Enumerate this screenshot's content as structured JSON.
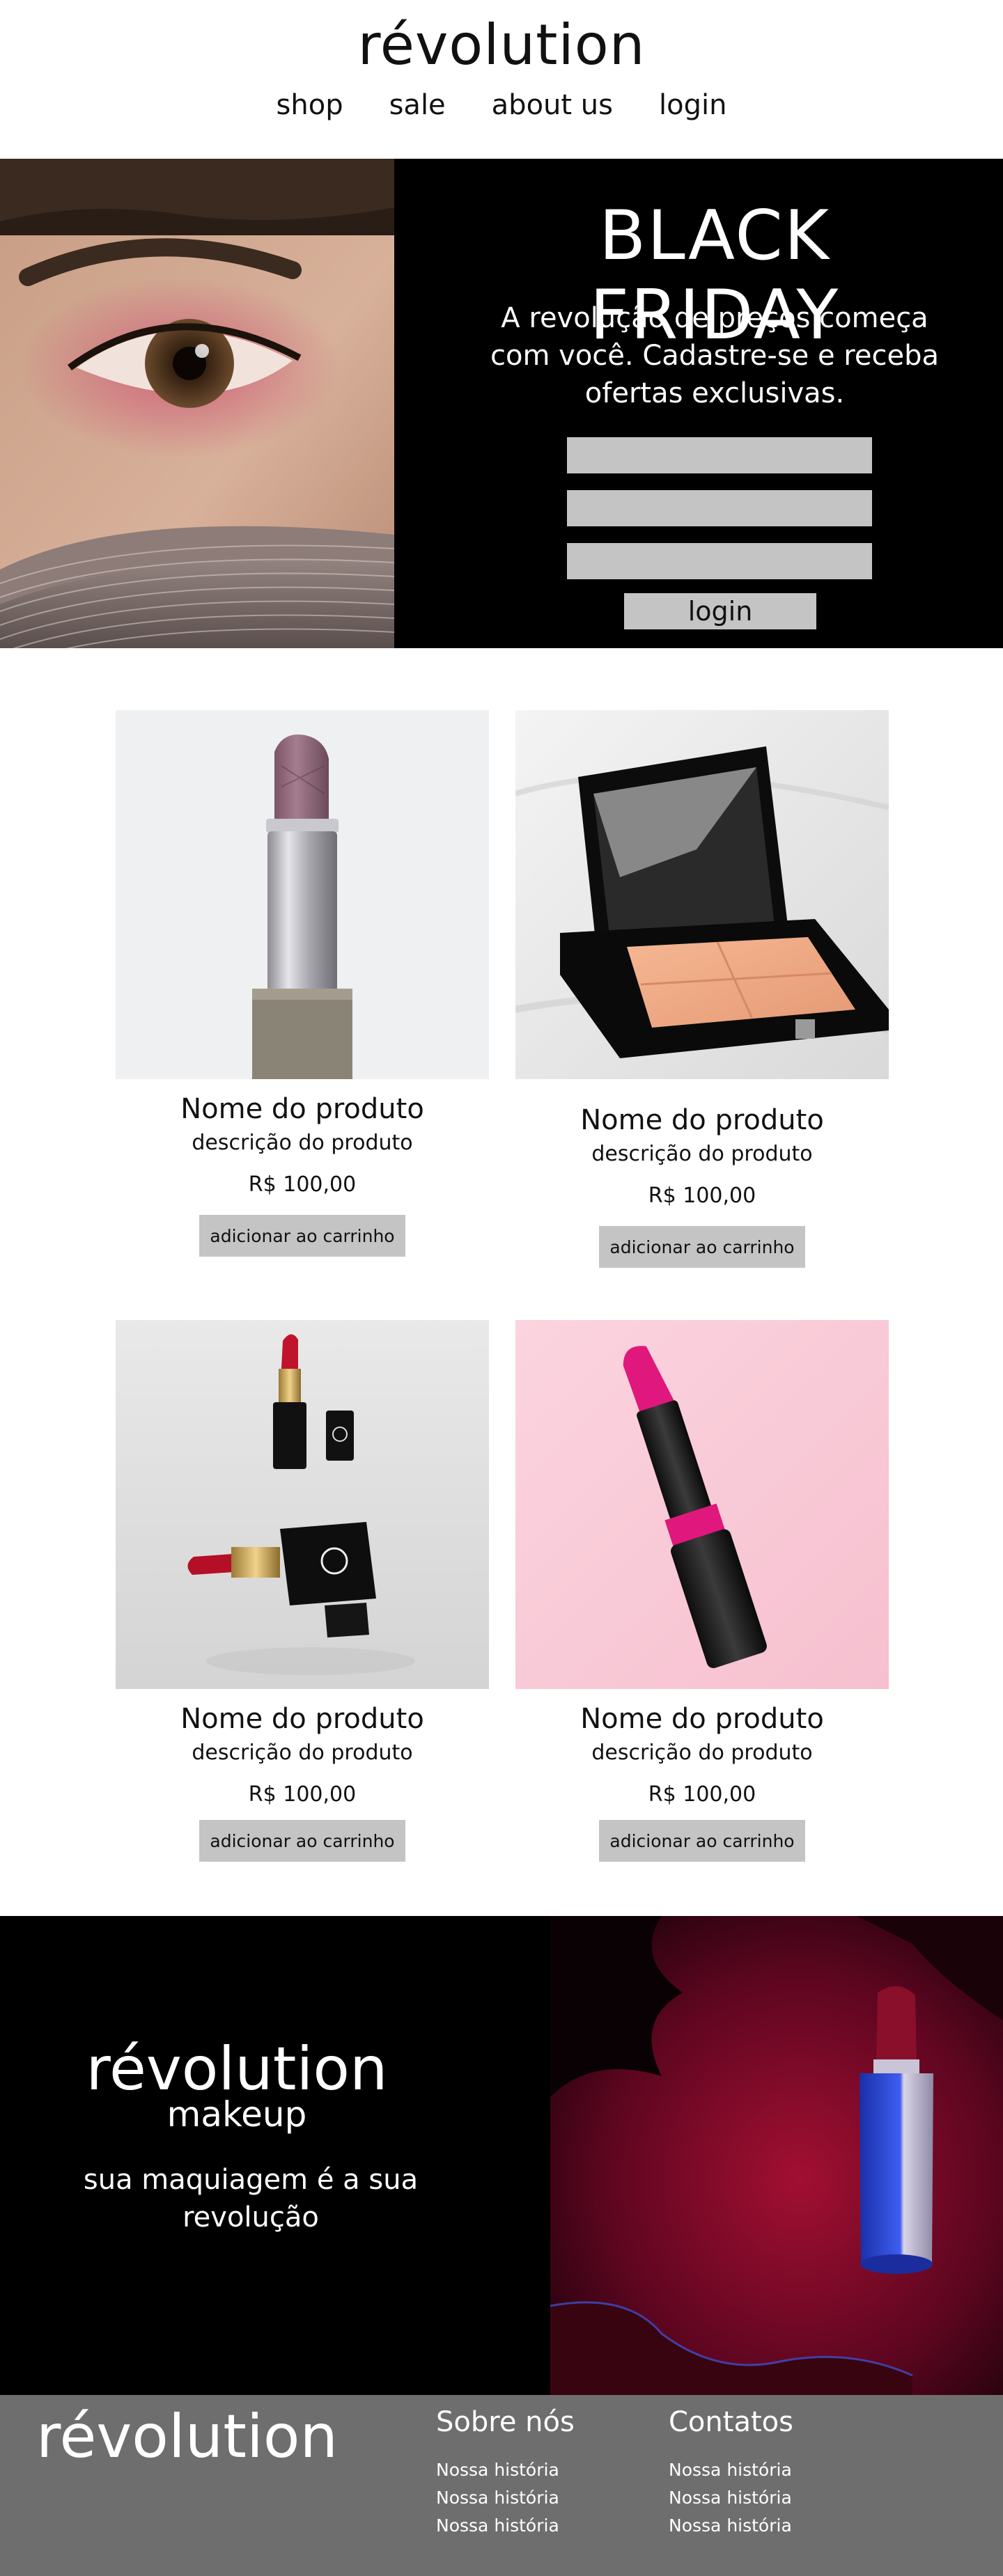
{
  "header": {
    "logo": "révolution",
    "nav": [
      "shop",
      "sale",
      "about us",
      "login"
    ]
  },
  "hero": {
    "title": "BLACK FRIDAY",
    "subtitle": "A revolução de preços começa com você. Cadastre-se e receba ofertas exclusivas.",
    "button_label": "login"
  },
  "products": [
    {
      "name": "Nome do produto",
      "description": "descrição do produto",
      "price": "R$ 100,00",
      "button": "adicionar ao carrinho"
    },
    {
      "name": "Nome do produto",
      "description": "descrição do produto",
      "price": "R$ 100,00",
      "button": "adicionar ao carrinho"
    },
    {
      "name": "Nome do produto",
      "description": "descrição do produto",
      "price": "R$ 100,00",
      "button": "adicionar ao carrinho"
    },
    {
      "name": "Nome do produto",
      "description": "descrição do produto",
      "price": "R$ 100,00",
      "button": "adicionar ao carrinho"
    }
  ],
  "promo": {
    "logo": "révolution",
    "sub": "makeup",
    "tagline": "sua maquiagem é a sua revolução"
  },
  "footer": {
    "logo": "révolution",
    "columns": [
      {
        "title": "Sobre nós",
        "links": [
          "Nossa história",
          "Nossa história",
          "Nossa história"
        ]
      },
      {
        "title": "Contatos",
        "links": [
          "Nossa história",
          "Nossa história",
          "Nossa história"
        ]
      }
    ]
  },
  "colors": {
    "black": "#000000",
    "button_gray": "#c4c4c4",
    "footer_gray": "#6d6e6d"
  }
}
